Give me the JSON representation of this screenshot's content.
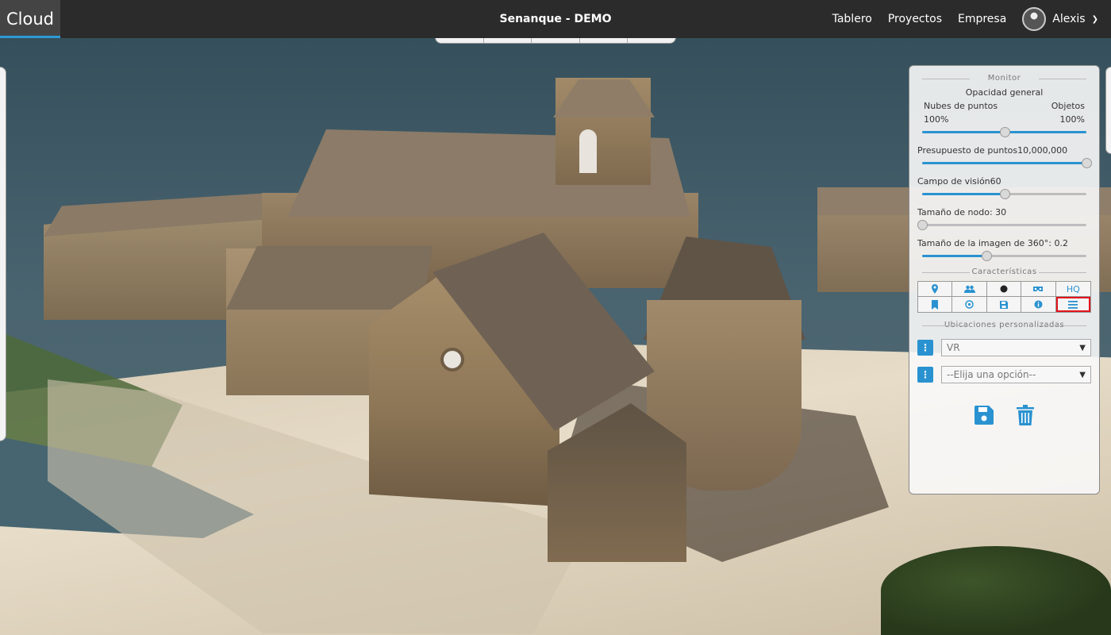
{
  "app": {
    "brand": "Cloud",
    "project_title": "Senanque - DEMO",
    "accent_color": "#2a92d0"
  },
  "nav": {
    "items": [
      "Tablero",
      "Proyectos",
      "Empresa"
    ],
    "user_name": "Alexis"
  },
  "monitor": {
    "title": "Monitor",
    "opacity": {
      "label": "Opacidad general",
      "left_label": "Nubes de puntos",
      "right_label": "Objetos",
      "left_value": "100%",
      "right_value": "100%",
      "level": 0.5
    },
    "point_budget": {
      "label": "Presupuesto de puntos",
      "value": "10,000,000",
      "level": 1.0
    },
    "fov": {
      "label": "Campo de visión",
      "value": "60",
      "level": 0.5
    },
    "node_size": {
      "label": "Tamaño de nodo: 30",
      "level": 0.0
    },
    "image360": {
      "label": "Tamaño de la imagen de 360°: 0.2",
      "level": 0.39
    }
  },
  "features": {
    "title": "Características",
    "buttons": [
      {
        "icon": "map-pin-icon"
      },
      {
        "icon": "users-icon"
      },
      {
        "icon": "circle-icon"
      },
      {
        "icon": "vr-glasses-icon"
      },
      {
        "label": "HQ"
      },
      {
        "icon": "bookmark-icon"
      },
      {
        "icon": "settings-circle-icon"
      },
      {
        "icon": "save-icon"
      },
      {
        "icon": "info-icon"
      },
      {
        "icon": "menu-icon",
        "active": true
      }
    ]
  },
  "locations": {
    "title": "Ubicaciones personalizadas",
    "select1_value": "VR",
    "select2_placeholder": "--Elija una opción--"
  }
}
